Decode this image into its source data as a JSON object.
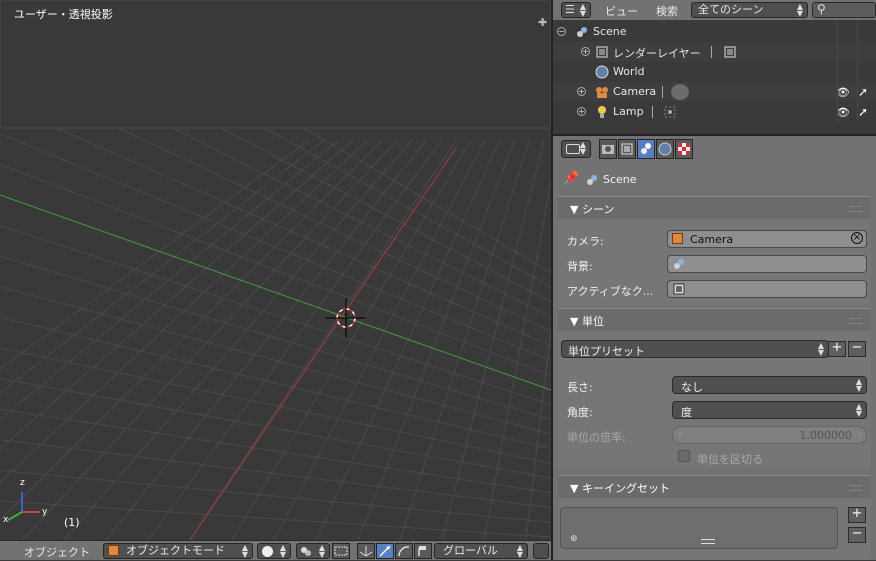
{
  "viewport": {
    "title": "ユーザー・透視投影",
    "frame": "(1)",
    "axis_x": "x",
    "axis_y": "y",
    "axis_z": "z"
  },
  "viewport_header": {
    "menu_label": "オブジェクト",
    "mode": "オブジェクトモード",
    "orientation": "グローバル"
  },
  "outliner_header": {
    "view": "ビュー",
    "search": "検索",
    "display": "全てのシーン"
  },
  "outliner": {
    "scene": "Scene",
    "render_layers": "レンダーレイヤー",
    "world": "World",
    "camera": "Camera",
    "lamp": "Lamp"
  },
  "properties": {
    "context": "Scene",
    "scene_panel": {
      "title": "シーン",
      "camera_label": "カメラ:",
      "camera_value": "Camera",
      "background_label": "背景:",
      "active_clip_label": "アクティブなク..."
    },
    "units_panel": {
      "title": "単位",
      "preset": "単位プリセット",
      "length_label": "長さ:",
      "length_value": "なし",
      "angle_label": "角度:",
      "angle_value": "度",
      "scale_label": "単位の倍率:",
      "scale_value": "1.000000",
      "separate_label": "単位を区切る"
    },
    "keying_panel": {
      "title": "キーイングセット"
    }
  },
  "colors": {
    "x_axis_line": "#a83c3c",
    "y_axis_line": "#3c9a3c",
    "active_tool": "#5680c2"
  }
}
